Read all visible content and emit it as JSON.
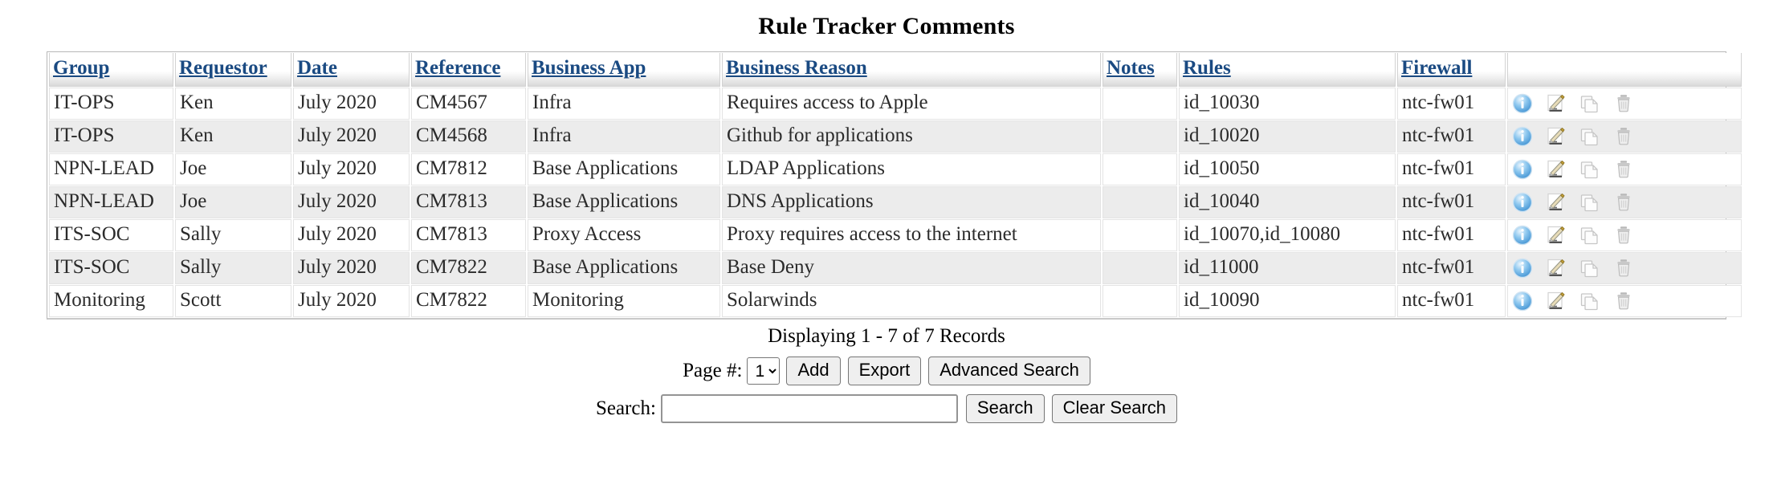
{
  "page": {
    "title": "Rule Tracker Comments"
  },
  "table": {
    "columns": [
      {
        "key": "group",
        "label": "Group",
        "sortable": true
      },
      {
        "key": "requestor",
        "label": "Requestor",
        "sortable": true
      },
      {
        "key": "date",
        "label": "Date",
        "sortable": true
      },
      {
        "key": "reference",
        "label": "Reference",
        "sortable": true
      },
      {
        "key": "business_app",
        "label": "Business App",
        "sortable": true
      },
      {
        "key": "business_reason",
        "label": "Business Reason",
        "sortable": true
      },
      {
        "key": "notes",
        "label": "Notes",
        "sortable": true
      },
      {
        "key": "rules",
        "label": "Rules",
        "sortable": true
      },
      {
        "key": "firewall",
        "label": "Firewall",
        "sortable": true
      },
      {
        "key": "actions",
        "label": "",
        "sortable": false
      }
    ],
    "rows": [
      {
        "group": "IT-OPS",
        "requestor": "Ken",
        "date": "July 2020",
        "reference": "CM4567",
        "business_app": "Infra",
        "business_reason": "Requires access to Apple",
        "notes": "",
        "rules": "id_10030",
        "firewall": "ntc-fw01"
      },
      {
        "group": "IT-OPS",
        "requestor": "Ken",
        "date": "July 2020",
        "reference": "CM4568",
        "business_app": "Infra",
        "business_reason": "Github for applications",
        "notes": "",
        "rules": "id_10020",
        "firewall": "ntc-fw01"
      },
      {
        "group": "NPN-LEAD",
        "requestor": "Joe",
        "date": "July 2020",
        "reference": "CM7812",
        "business_app": "Base Applications",
        "business_reason": "LDAP Applications",
        "notes": "",
        "rules": "id_10050",
        "firewall": "ntc-fw01"
      },
      {
        "group": "NPN-LEAD",
        "requestor": "Joe",
        "date": "July 2020",
        "reference": "CM7813",
        "business_app": "Base Applications",
        "business_reason": "DNS Applications",
        "notes": "",
        "rules": "id_10040",
        "firewall": "ntc-fw01"
      },
      {
        "group": "ITS-SOC",
        "requestor": "Sally",
        "date": "July 2020",
        "reference": "CM7813",
        "business_app": "Proxy Access",
        "business_reason": "Proxy requires access to the internet",
        "notes": "",
        "rules": "id_10070,id_10080",
        "firewall": "ntc-fw01"
      },
      {
        "group": "ITS-SOC",
        "requestor": "Sally",
        "date": "July 2020",
        "reference": "CM7822",
        "business_app": "Base Applications",
        "business_reason": "Base Deny",
        "notes": "",
        "rules": "id_11000",
        "firewall": "ntc-fw01"
      },
      {
        "group": "Monitoring",
        "requestor": "Scott",
        "date": "July 2020",
        "reference": "CM7822",
        "business_app": "Monitoring",
        "business_reason": "Solarwinds",
        "notes": "",
        "rules": "id_10090",
        "firewall": "ntc-fw01"
      }
    ],
    "row_actions": [
      {
        "name": "info-icon",
        "title": "Info"
      },
      {
        "name": "edit-icon",
        "title": "Edit"
      },
      {
        "name": "copy-icon",
        "title": "Copy"
      },
      {
        "name": "delete-icon",
        "title": "Delete"
      }
    ]
  },
  "footer": {
    "records_text": "Displaying 1 - 7 of 7 Records",
    "page_label": "Page #:",
    "page_value": "1",
    "page_options": [
      "1"
    ],
    "add_label": "Add",
    "export_label": "Export",
    "advanced_search_label": "Advanced Search",
    "search_label": "Search:",
    "search_value": "",
    "search_placeholder": "",
    "search_button_label": "Search",
    "clear_search_label": "Clear Search"
  },
  "colors": {
    "link": "#1a4a82",
    "row_alt": "#ececec",
    "info_icon": "#4a9fe0",
    "border": "#d2d2d2"
  }
}
